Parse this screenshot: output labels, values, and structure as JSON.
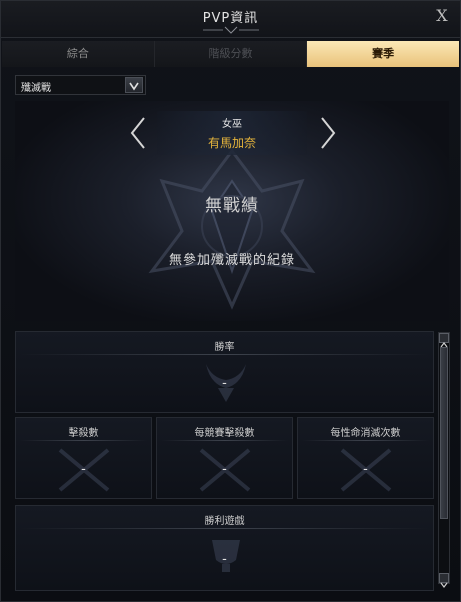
{
  "window": {
    "title": "PVP資訊",
    "close_label": "X"
  },
  "tabs": [
    {
      "label": "綜合",
      "state": "normal"
    },
    {
      "label": "階級分數",
      "state": "disabled"
    },
    {
      "label": "賽季",
      "state": "selected"
    }
  ],
  "mode_select": {
    "value": "殲滅戰"
  },
  "character": {
    "class_name": "女巫",
    "name": "有馬加奈",
    "name_color": "#e6b53c"
  },
  "record": {
    "status": "無戰績",
    "message": "無參加殲滅戰的紀錄"
  },
  "stats": {
    "win_rate": {
      "label": "勝率",
      "value": "-"
    },
    "kills": {
      "label": "擊殺數",
      "value": "-"
    },
    "kills_per_match": {
      "label": "每競賽擊殺數",
      "value": "-"
    },
    "eliminations_per_life": {
      "label": "每性命消滅次數",
      "value": "-"
    },
    "wins": {
      "label": "勝利遊戲",
      "value": "-"
    }
  },
  "colors": {
    "active_tab": "#e9c27a",
    "accent_gold": "#e6b53c"
  }
}
